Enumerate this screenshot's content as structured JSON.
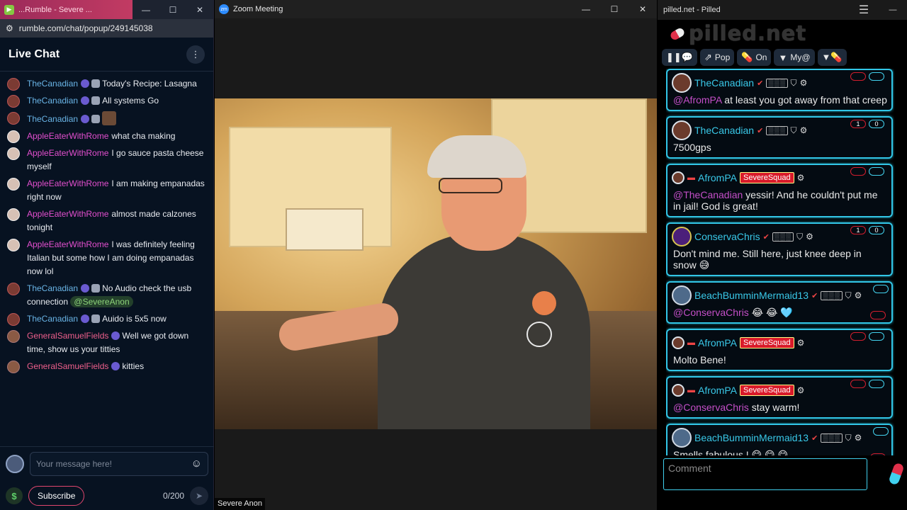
{
  "rumble": {
    "tab_title": "...Rumble - Severe ...",
    "url": "rumble.com/chat/popup/249145038",
    "header_title": "Live Chat",
    "messages": [
      {
        "user": "TheCanadian",
        "type": "can",
        "text": "Today's Recipe: Lasagna"
      },
      {
        "user": "TheCanadian",
        "type": "can",
        "text": "All systems Go"
      },
      {
        "user": "TheCanadian",
        "type": "can",
        "text": "",
        "emote": true
      },
      {
        "user": "AppleEaterWithRome",
        "type": "apple",
        "text": "what cha making"
      },
      {
        "user": "AppleEaterWithRome",
        "type": "apple",
        "text": "I go sauce pasta cheese myself"
      },
      {
        "user": "AppleEaterWithRome",
        "type": "apple",
        "text": "I am making empanadas right now"
      },
      {
        "user": "AppleEaterWithRome",
        "type": "apple",
        "text": "almost made calzones tonight"
      },
      {
        "user": "AppleEaterWithRome",
        "type": "apple",
        "text": "I was definitely feeling Italian but some how I am doing empanadas now lol"
      },
      {
        "user": "TheCanadian",
        "type": "can",
        "text": "No Audio check the usb connection",
        "mention": "@SevereAnon"
      },
      {
        "user": "TheCanadian",
        "type": "can",
        "text": "Auido is 5x5 now"
      },
      {
        "user": "GeneralSamuelFields",
        "type": "gen",
        "text": "Well we got down time, show us your titties"
      },
      {
        "user": "GeneralSamuelFields",
        "type": "gen",
        "text": "kitties"
      }
    ],
    "input_placeholder": "Your message here!",
    "subscribe_label": "Subscribe",
    "char_count": "0/200"
  },
  "zoom": {
    "window_title": "Zoom Meeting",
    "participant_name": "Severe Anon"
  },
  "pilled": {
    "window_title": "pilled.net - Pilled",
    "logo_text": "pilled.net",
    "tools": {
      "pop": "Pop",
      "on": "On",
      "my": "My@"
    },
    "comment_placeholder": "Comment",
    "cards": [
      {
        "name": "TheCanadian",
        "av": "can",
        "tag": "",
        "mention": "@AfromPA",
        "text": " at least you got away from that creep",
        "down": "",
        "up": ""
      },
      {
        "name": "TheCanadian",
        "av": "can",
        "tag": "",
        "mention": "",
        "text": "7500gps",
        "down": "1",
        "up": "0"
      },
      {
        "name": "AfromPA",
        "av": "afro",
        "tag": "SevereSquad",
        "mention": "@TheCanadian",
        "text": " yessir! And he couldn't put me in jail! God is great!",
        "down": "",
        "up": ""
      },
      {
        "name": "ConservaChris",
        "av": "cons",
        "tag": "",
        "mention": "",
        "text": "Don't mind me. Still here, just knee deep in snow 😅",
        "down": "1",
        "up": "0"
      },
      {
        "name": "BeachBumminMermaid13",
        "av": "beach",
        "tag": "",
        "mention": "@ConservaChris",
        "text": " 😂 😂 🩵",
        "down": "",
        "up": ""
      },
      {
        "name": "AfromPA",
        "av": "afro",
        "tag": "SevereSquad",
        "mention": "",
        "text": "Molto Bene!",
        "down": "",
        "up": ""
      },
      {
        "name": "AfromPA",
        "av": "afro",
        "tag": "SevereSquad",
        "mention": "@ConservaChris",
        "text": " stay warm!",
        "down": "",
        "up": ""
      },
      {
        "name": "BeachBumminMermaid13",
        "av": "beach",
        "tag": "",
        "mention": "",
        "text": "Smells fabulous ! 😋 😋 😋",
        "down": "",
        "up": ""
      }
    ]
  }
}
